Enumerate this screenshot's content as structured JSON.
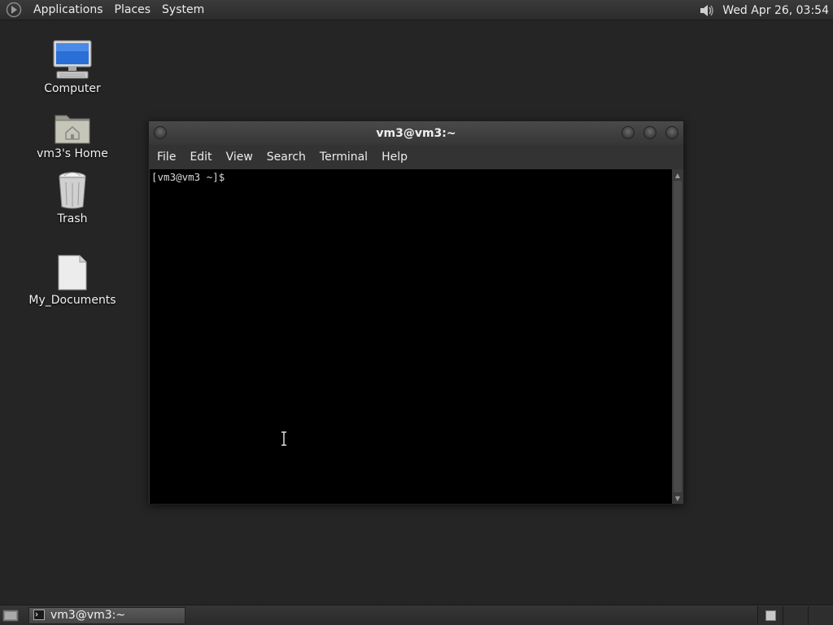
{
  "top_panel": {
    "menus": [
      "Applications",
      "Places",
      "System"
    ],
    "clock": "Wed Apr 26, 03:54"
  },
  "desktop": {
    "icons": [
      {
        "label": "Computer",
        "icon": "computer-icon"
      },
      {
        "label": "vm3's Home",
        "icon": "home-folder-icon"
      },
      {
        "label": "Trash",
        "icon": "trash-icon"
      },
      {
        "label": "My_Documents",
        "icon": "document-icon"
      }
    ]
  },
  "terminal": {
    "title": "vm3@vm3:~",
    "menus": [
      "File",
      "Edit",
      "View",
      "Search",
      "Terminal",
      "Help"
    ],
    "prompt": "[vm3@vm3 ~]$"
  },
  "bottom_panel": {
    "task_label": "vm3@vm3:~"
  },
  "colors": {
    "desktop_bg": "#252525",
    "panel_bg": "#2e2e2e",
    "terminal_bg": "#000000",
    "terminal_fg": "#d8d8d8"
  }
}
